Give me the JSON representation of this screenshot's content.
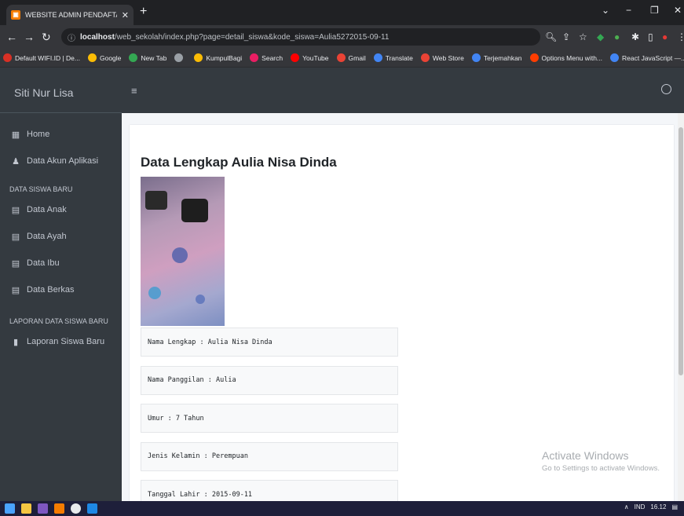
{
  "browser": {
    "tab_title": "WEBSITE ADMIN PENDAFTARAN",
    "new_tab": "+",
    "url_host": "localhost",
    "url_path": "/web_sekolah/index.php?page=detail_siswa&kode_siswa=Aulia5272015-09-11",
    "bookmarks": [
      {
        "label": "Default WIFI.ID | De...",
        "color": "#d93025"
      },
      {
        "label": "Google",
        "color": "#fbbc05"
      },
      {
        "label": "New Tab",
        "color": "#34a853"
      },
      {
        "label": "",
        "color": "#9aa0a6"
      },
      {
        "label": "KumpulBagi",
        "color": "#fbbc05"
      },
      {
        "label": "Search",
        "color": "#e91e63"
      },
      {
        "label": "YouTube",
        "color": "#ff0000"
      },
      {
        "label": "Gmail",
        "color": "#ea4335"
      },
      {
        "label": "Translate",
        "color": "#4285f4"
      },
      {
        "label": "Web Store",
        "color": "#ea4335"
      },
      {
        "label": "Terjemahkan",
        "color": "#4285f4"
      },
      {
        "label": "Options Menu with...",
        "color": "#ff3d00"
      },
      {
        "label": "React JavaScript —...",
        "color": "#4285f4"
      }
    ]
  },
  "sidebar": {
    "brand": "Siti Nur Lisa",
    "items_top": [
      {
        "label": "Home",
        "icon": "th-icon"
      },
      {
        "label": "Data Akun Aplikasi",
        "icon": "user-icon"
      }
    ],
    "header_1": "DATA SISWA BARU",
    "items_siswa": [
      {
        "label": "Data Anak",
        "icon": "table-icon"
      },
      {
        "label": "Data Ayah",
        "icon": "table-icon"
      },
      {
        "label": "Data Ibu",
        "icon": "table-icon"
      },
      {
        "label": "Data Berkas",
        "icon": "table-icon"
      }
    ],
    "header_2": "LAPORAN DATA SISWA BARU",
    "items_laporan": [
      {
        "label": "Laporan Siswa Baru",
        "icon": "book-icon"
      }
    ]
  },
  "topnav": {
    "menu_glyph": "≡"
  },
  "main": {
    "title": "Data Lengkap Aulia Nisa Dinda",
    "fields": [
      "Nama Lengkap : Aulia Nisa Dinda",
      "Nama Panggilan : Aulia",
      "Umur : 7 Tahun",
      "Jenis Kelamin : Perempuan",
      "Tanggal Lahir : 2015-09-11"
    ]
  },
  "watermark": {
    "line1": "Activate Windows",
    "line2": "Go to Settings to activate Windows."
  },
  "taskbar": {
    "lang": "IND",
    "time": "16.12"
  }
}
